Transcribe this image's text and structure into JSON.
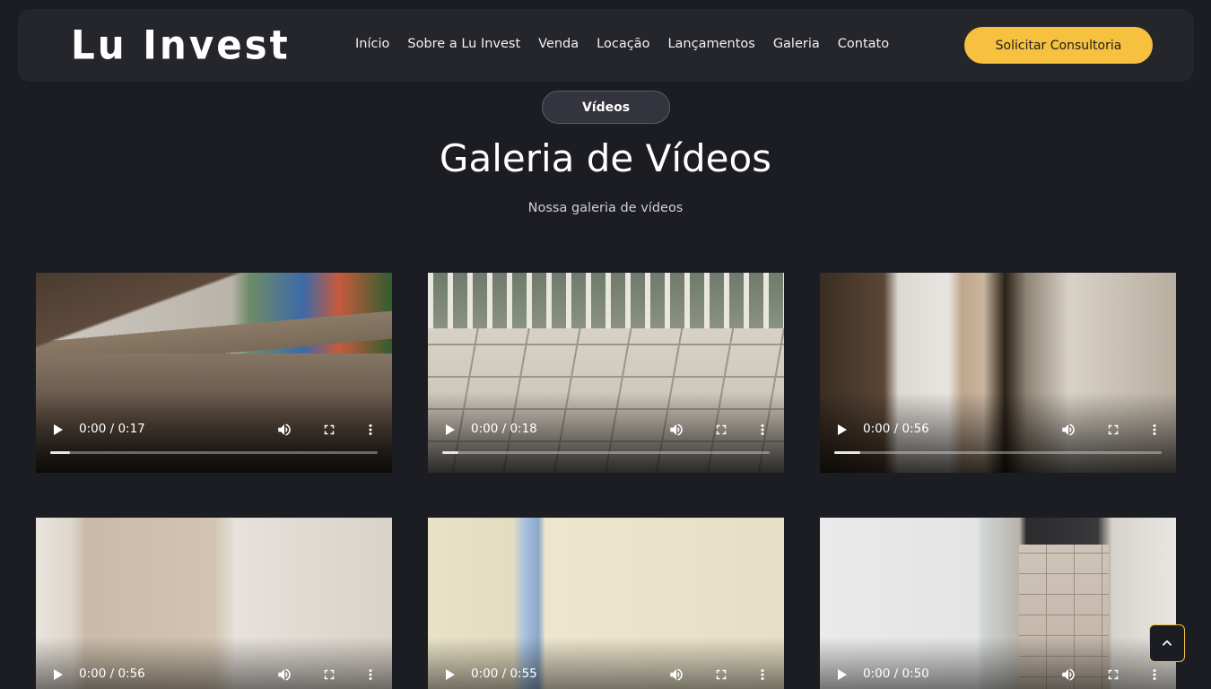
{
  "header": {
    "logo": "Lu Invest",
    "nav": [
      "Início",
      "Sobre a Lu Invest",
      "Venda",
      "Locação",
      "Lançamentos",
      "Galeria",
      "Contato"
    ],
    "cta": "Solicitar Consultoria"
  },
  "section": {
    "pill": "Vídeos",
    "title": "Galeria de Vídeos",
    "subtitle": "Nossa galeria de vídeos"
  },
  "videos": [
    {
      "time": "0:00 / 0:17",
      "progress": 0.06
    },
    {
      "time": "0:00 / 0:18",
      "progress": 0.05
    },
    {
      "time": "0:00 / 0:56",
      "progress": 0.08
    },
    {
      "time": "0:00 / 0:56",
      "progress": 0.0
    },
    {
      "time": "0:00 / 0:55",
      "progress": 0.0
    },
    {
      "time": "0:00 / 0:50",
      "progress": 0.0
    }
  ],
  "colors": {
    "background": "#1c1d22",
    "header": "#25262c",
    "accent": "#f5c13e"
  },
  "icons": [
    "play-icon",
    "volume-icon",
    "fullscreen-icon",
    "more-options-icon",
    "chevron-up-icon"
  ]
}
